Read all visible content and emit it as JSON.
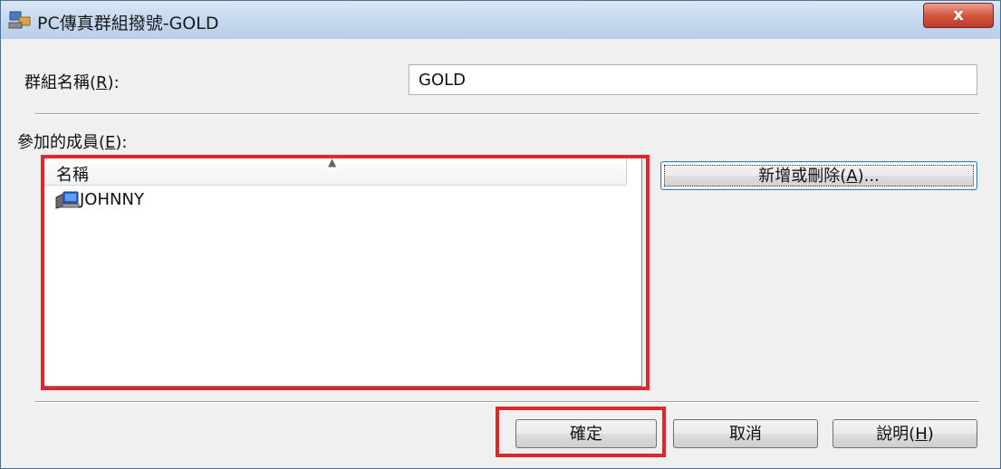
{
  "window": {
    "title": "PC傳真群組撥號-GOLD",
    "close_label": "x"
  },
  "group_name": {
    "label_prefix": "群組名稱(",
    "label_accel": "R",
    "label_suffix": "):",
    "value": "GOLD"
  },
  "members": {
    "label_prefix": "參加的成員(",
    "label_accel": "E",
    "label_suffix": "):",
    "column_header": "名稱",
    "sort_indicator": "▲",
    "items": [
      {
        "name": "JOHNNY",
        "icon": "fax-computer-icon"
      }
    ]
  },
  "add_remove_button": {
    "prefix": "新增或刪除(",
    "accel": "A",
    "suffix": ")..."
  },
  "footer": {
    "ok_label": "確定",
    "cancel_label": "取消",
    "help_prefix": "說明(",
    "help_accel": "H",
    "help_suffix": ")"
  },
  "colors": {
    "highlight": "#e0282b",
    "titlebar": "#c7daf0",
    "close_button": "#c0392b"
  }
}
